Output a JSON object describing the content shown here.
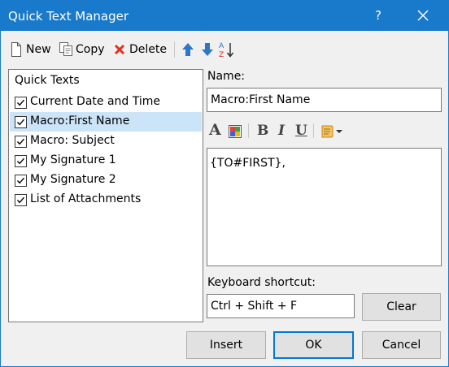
{
  "window": {
    "title": "Quick Text Manager",
    "help": "?"
  },
  "toolbar": {
    "new_label": "New",
    "copy_label": "Copy",
    "delete_label": "Delete"
  },
  "list": {
    "header": "Quick Texts",
    "items": [
      {
        "label": "Current Date and Time",
        "checked": true,
        "selected": false
      },
      {
        "label": "Macro:First Name",
        "checked": true,
        "selected": true
      },
      {
        "label": "Macro: Subject",
        "checked": true,
        "selected": false
      },
      {
        "label": "My Signature 1",
        "checked": true,
        "selected": false
      },
      {
        "label": "My Signature 2",
        "checked": true,
        "selected": false
      },
      {
        "label": "List of Attachments",
        "checked": true,
        "selected": false
      }
    ]
  },
  "editor": {
    "name_label": "Name:",
    "name_value": "Macro:First Name",
    "body_text": "{TO#FIRST},",
    "shortcut_label": "Keyboard shortcut:",
    "shortcut_value": "Ctrl + Shift + F",
    "clear_label": "Clear"
  },
  "format_toolbar": {
    "font_icon": "A",
    "bold": "B",
    "italic": "I",
    "underline": "U"
  },
  "buttons": {
    "insert": "Insert",
    "ok": "OK",
    "cancel": "Cancel"
  },
  "colors": {
    "titlebar": "#1979ca",
    "selection": "#cce4f7",
    "focus_border": "#0078d7"
  }
}
